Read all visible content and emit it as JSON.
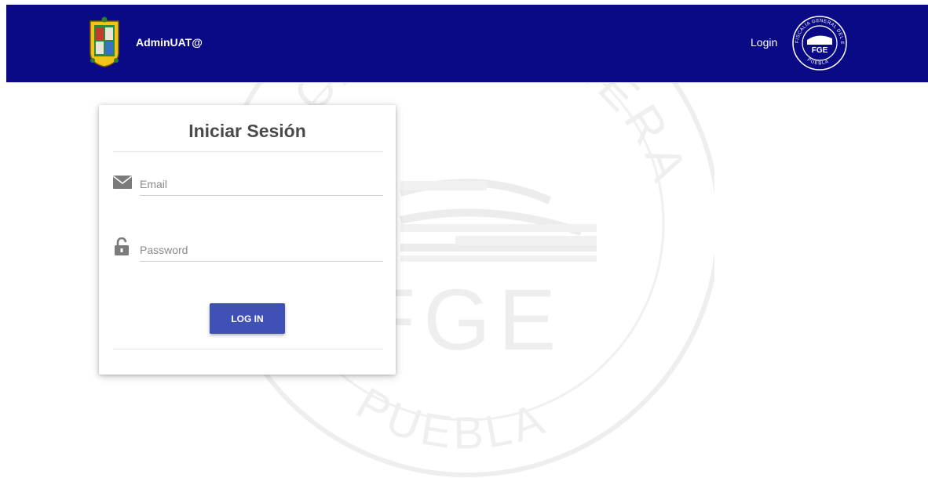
{
  "header": {
    "brand_name": "AdminUAT@",
    "brand_logo_icon": "puebla-coat-of-arms-icon",
    "nav_login_label": "Login",
    "seal_icon": "fge-seal-icon",
    "seal_text": "FGE",
    "seal_ring_top": "FISCALÍA GENERAL DEL ESTADO",
    "seal_ring_bottom": "PUEBLA",
    "background_color": "#0a0a86"
  },
  "watermark": {
    "ring_top": "FISCALÍA GENERAL DEL ESTADO",
    "ring_bottom": "PUEBLA",
    "text": "FGE"
  },
  "login_card": {
    "title": "Iniciar Sesión",
    "email": {
      "icon": "envelope-icon",
      "placeholder": "Email",
      "value": ""
    },
    "password": {
      "icon": "unlocked-padlock-icon",
      "placeholder": "Password",
      "value": ""
    },
    "submit_label": "LOG IN",
    "button_color": "#3f51b5"
  }
}
